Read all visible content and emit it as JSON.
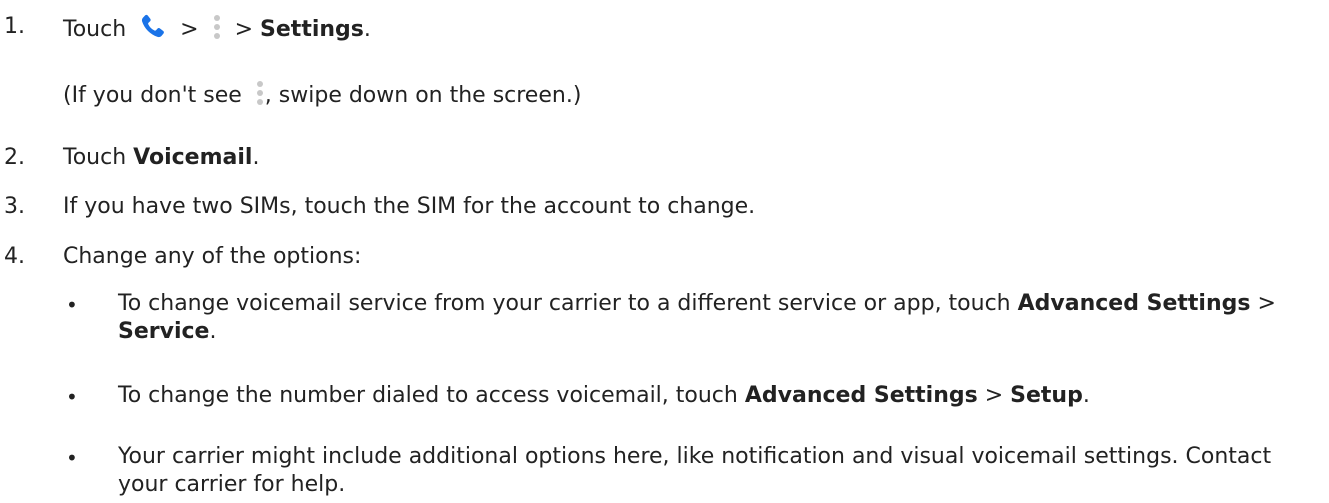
{
  "steps": [
    {
      "num": "1.",
      "touch": "Touch",
      "sep1": ">",
      "sep2": ">",
      "settings": "Settings",
      "period": "."
    },
    {
      "num": "2.",
      "touch": "Touch",
      "bold": "Voicemail",
      "period": "."
    },
    {
      "num": "3.",
      "text": "If you have two SIMs, touch the SIM for the account to change."
    },
    {
      "num": "4.",
      "text": "Change any of the options:"
    }
  ],
  "note": {
    "before": "(If you don't see",
    "after": ", swipe down on the screen.)"
  },
  "bullets": [
    {
      "symbol": "•",
      "pre": "To change voicemail service from your carrier to a different service or app, touch",
      "b1": "Advanced Settings",
      "sep": ">",
      "b2": "Service",
      "end": "."
    },
    {
      "symbol": "•",
      "pre": "To change the number dialed to access voicemail, touch",
      "b1": "Advanced Settings",
      "sep": ">",
      "b2": "Setup",
      "end": "."
    },
    {
      "symbol": "•",
      "text": "Your carrier might include additional options here, like notification and visual voicemail settings. Contact your carrier for help."
    }
  ],
  "icons": {
    "phone": "phone-icon",
    "menu": "more-vert-icon"
  },
  "colors": {
    "phone": "#1a73e8",
    "dots": "#c8c8c8"
  }
}
